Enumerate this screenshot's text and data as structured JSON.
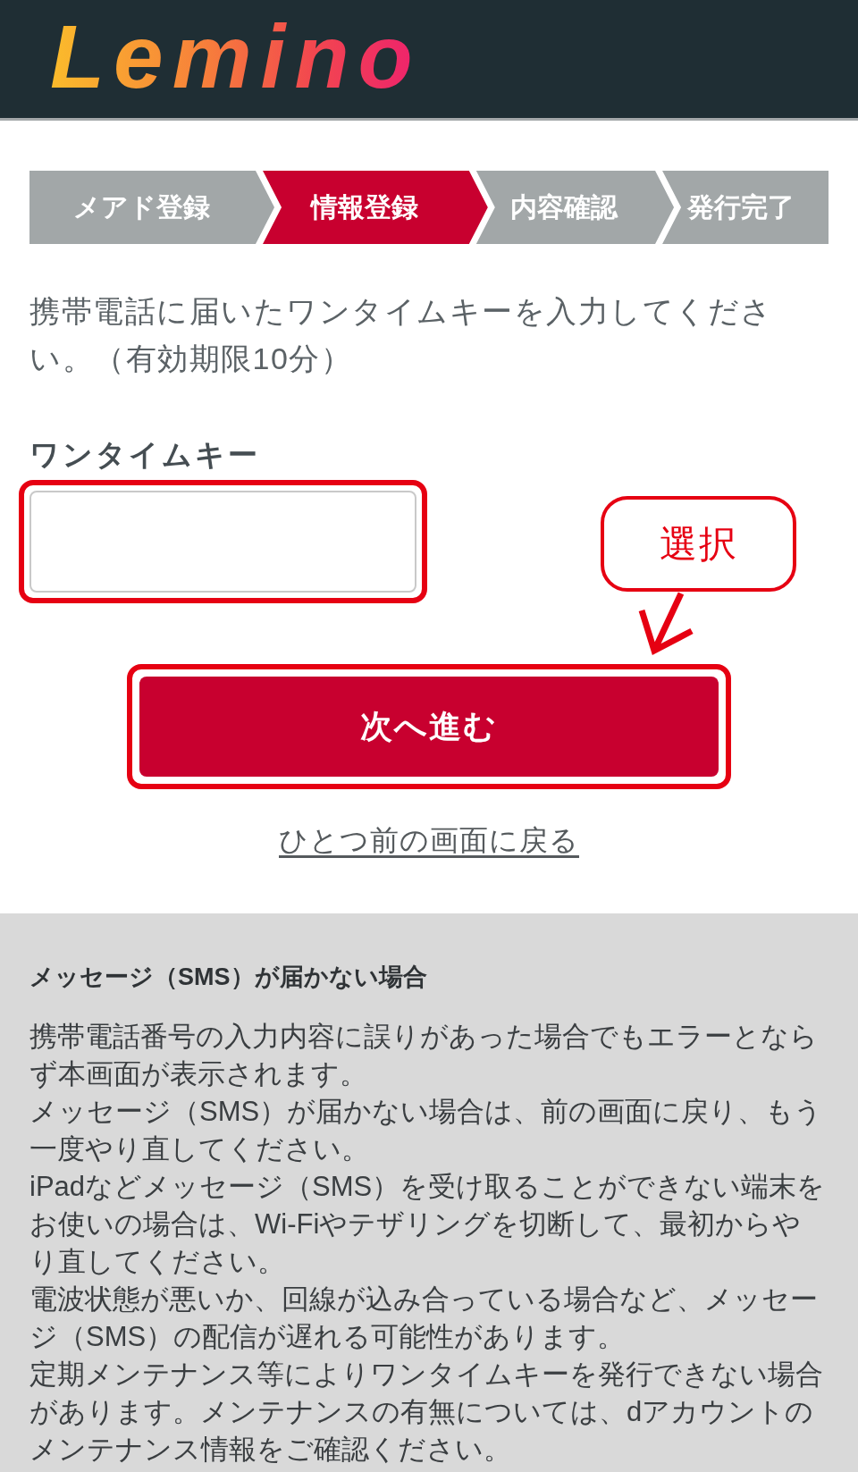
{
  "header": {
    "logo": "Lemino"
  },
  "steps": [
    {
      "label": "メアド登録",
      "current": false
    },
    {
      "label": "情報登録",
      "current": true
    },
    {
      "label": "内容確認",
      "current": false
    },
    {
      "label": "発行完了",
      "current": false
    }
  ],
  "instruction": "携帯電話に届いたワンタイムキーを入力してください。（有効期限10分）",
  "key_field": {
    "label": "ワンタイムキー",
    "highlighted": true
  },
  "next_button": {
    "label": "次へ進む",
    "highlighted": true
  },
  "callout": {
    "text": "選択"
  },
  "back_link": "ひとつ前の画面に戻る",
  "sms_help": {
    "title": "メッセージ（SMS）が届かない場合",
    "paragraphs": [
      "携帯電話番号の入力内容に誤りがあった場合でもエラーとならず本画面が表示されます。",
      "メッセージ（SMS）が届かない場合は、前の画面に戻り、もう一度やり直してください。",
      "iPadなどメッセージ（SMS）を受け取ることができない端末をお使いの場合は、Wi-Fiやテザリングを切断して、最初からやり直してください。",
      "電波状態が悪いか、回線が込み合っている場合など、メッセージ（SMS）の配信が遅れる可能性があります。",
      "定期メンテナンス等によりワンタイムキーを発行できない場合があります。メンテナンスの有無については、dアカウントのメンテナンス情報をご確認ください。"
    ]
  }
}
